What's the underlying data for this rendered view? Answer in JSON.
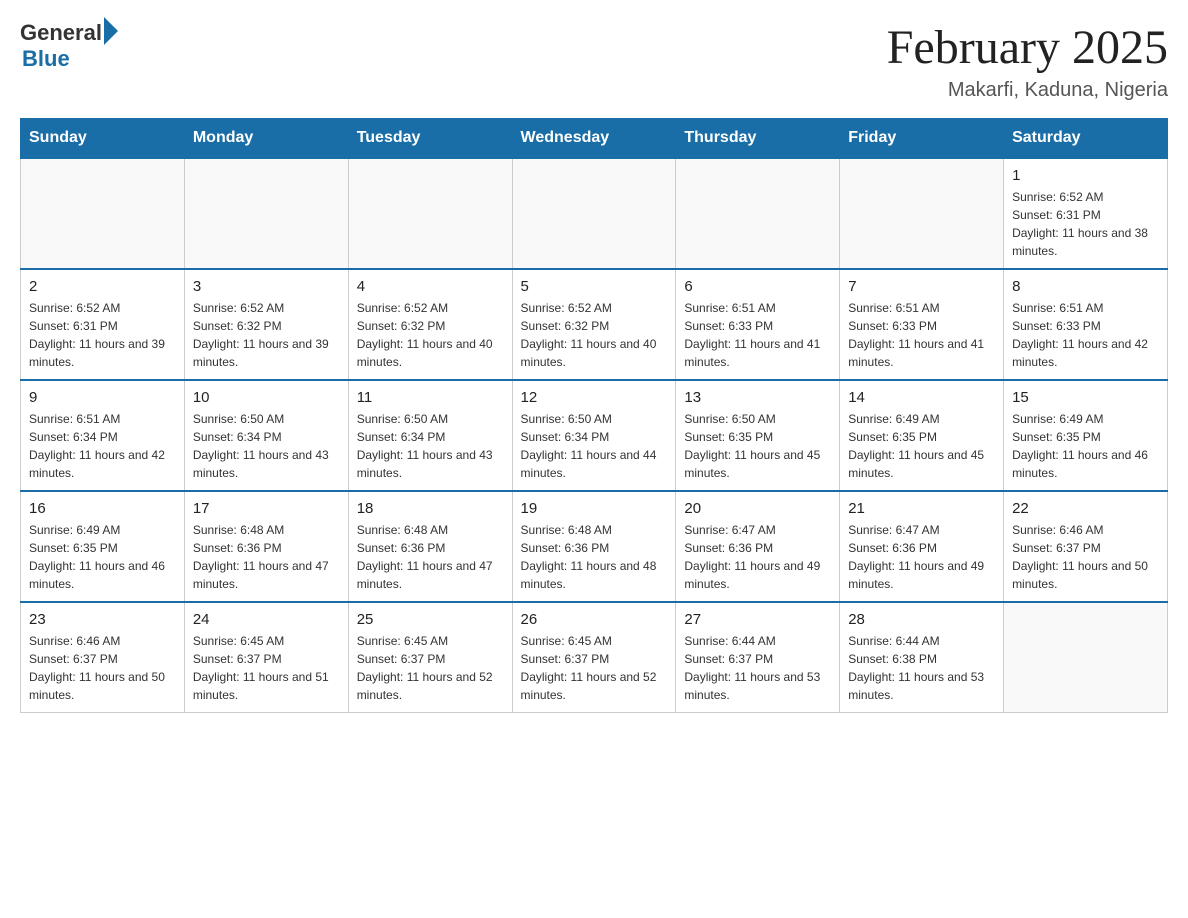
{
  "header": {
    "logo_general": "General",
    "logo_blue": "Blue",
    "month_title": "February 2025",
    "location": "Makarfi, Kaduna, Nigeria"
  },
  "days_of_week": [
    "Sunday",
    "Monday",
    "Tuesday",
    "Wednesday",
    "Thursday",
    "Friday",
    "Saturday"
  ],
  "weeks": [
    [
      {
        "day": "",
        "info": ""
      },
      {
        "day": "",
        "info": ""
      },
      {
        "day": "",
        "info": ""
      },
      {
        "day": "",
        "info": ""
      },
      {
        "day": "",
        "info": ""
      },
      {
        "day": "",
        "info": ""
      },
      {
        "day": "1",
        "info": "Sunrise: 6:52 AM\nSunset: 6:31 PM\nDaylight: 11 hours and 38 minutes."
      }
    ],
    [
      {
        "day": "2",
        "info": "Sunrise: 6:52 AM\nSunset: 6:31 PM\nDaylight: 11 hours and 39 minutes."
      },
      {
        "day": "3",
        "info": "Sunrise: 6:52 AM\nSunset: 6:32 PM\nDaylight: 11 hours and 39 minutes."
      },
      {
        "day": "4",
        "info": "Sunrise: 6:52 AM\nSunset: 6:32 PM\nDaylight: 11 hours and 40 minutes."
      },
      {
        "day": "5",
        "info": "Sunrise: 6:52 AM\nSunset: 6:32 PM\nDaylight: 11 hours and 40 minutes."
      },
      {
        "day": "6",
        "info": "Sunrise: 6:51 AM\nSunset: 6:33 PM\nDaylight: 11 hours and 41 minutes."
      },
      {
        "day": "7",
        "info": "Sunrise: 6:51 AM\nSunset: 6:33 PM\nDaylight: 11 hours and 41 minutes."
      },
      {
        "day": "8",
        "info": "Sunrise: 6:51 AM\nSunset: 6:33 PM\nDaylight: 11 hours and 42 minutes."
      }
    ],
    [
      {
        "day": "9",
        "info": "Sunrise: 6:51 AM\nSunset: 6:34 PM\nDaylight: 11 hours and 42 minutes."
      },
      {
        "day": "10",
        "info": "Sunrise: 6:50 AM\nSunset: 6:34 PM\nDaylight: 11 hours and 43 minutes."
      },
      {
        "day": "11",
        "info": "Sunrise: 6:50 AM\nSunset: 6:34 PM\nDaylight: 11 hours and 43 minutes."
      },
      {
        "day": "12",
        "info": "Sunrise: 6:50 AM\nSunset: 6:34 PM\nDaylight: 11 hours and 44 minutes."
      },
      {
        "day": "13",
        "info": "Sunrise: 6:50 AM\nSunset: 6:35 PM\nDaylight: 11 hours and 45 minutes."
      },
      {
        "day": "14",
        "info": "Sunrise: 6:49 AM\nSunset: 6:35 PM\nDaylight: 11 hours and 45 minutes."
      },
      {
        "day": "15",
        "info": "Sunrise: 6:49 AM\nSunset: 6:35 PM\nDaylight: 11 hours and 46 minutes."
      }
    ],
    [
      {
        "day": "16",
        "info": "Sunrise: 6:49 AM\nSunset: 6:35 PM\nDaylight: 11 hours and 46 minutes."
      },
      {
        "day": "17",
        "info": "Sunrise: 6:48 AM\nSunset: 6:36 PM\nDaylight: 11 hours and 47 minutes."
      },
      {
        "day": "18",
        "info": "Sunrise: 6:48 AM\nSunset: 6:36 PM\nDaylight: 11 hours and 47 minutes."
      },
      {
        "day": "19",
        "info": "Sunrise: 6:48 AM\nSunset: 6:36 PM\nDaylight: 11 hours and 48 minutes."
      },
      {
        "day": "20",
        "info": "Sunrise: 6:47 AM\nSunset: 6:36 PM\nDaylight: 11 hours and 49 minutes."
      },
      {
        "day": "21",
        "info": "Sunrise: 6:47 AM\nSunset: 6:36 PM\nDaylight: 11 hours and 49 minutes."
      },
      {
        "day": "22",
        "info": "Sunrise: 6:46 AM\nSunset: 6:37 PM\nDaylight: 11 hours and 50 minutes."
      }
    ],
    [
      {
        "day": "23",
        "info": "Sunrise: 6:46 AM\nSunset: 6:37 PM\nDaylight: 11 hours and 50 minutes."
      },
      {
        "day": "24",
        "info": "Sunrise: 6:45 AM\nSunset: 6:37 PM\nDaylight: 11 hours and 51 minutes."
      },
      {
        "day": "25",
        "info": "Sunrise: 6:45 AM\nSunset: 6:37 PM\nDaylight: 11 hours and 52 minutes."
      },
      {
        "day": "26",
        "info": "Sunrise: 6:45 AM\nSunset: 6:37 PM\nDaylight: 11 hours and 52 minutes."
      },
      {
        "day": "27",
        "info": "Sunrise: 6:44 AM\nSunset: 6:37 PM\nDaylight: 11 hours and 53 minutes."
      },
      {
        "day": "28",
        "info": "Sunrise: 6:44 AM\nSunset: 6:38 PM\nDaylight: 11 hours and 53 minutes."
      },
      {
        "day": "",
        "info": ""
      }
    ]
  ]
}
